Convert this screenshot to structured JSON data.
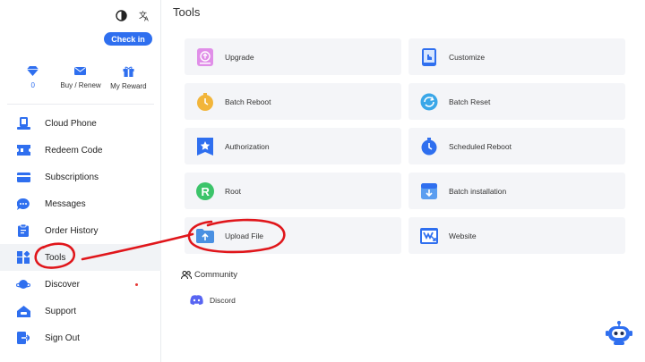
{
  "sidebar": {
    "checkin_label": "Check in",
    "stats": [
      {
        "icon": "diamond-icon",
        "label": "0"
      },
      {
        "icon": "mail-icon",
        "label": "Buy / Renew"
      },
      {
        "icon": "gift-icon",
        "label": "My Reward"
      }
    ],
    "nav": [
      {
        "key": "cloud-phone",
        "label": "Cloud Phone",
        "icon": "phone-icon"
      },
      {
        "key": "redeem-code",
        "label": "Redeem Code",
        "icon": "ticket-icon"
      },
      {
        "key": "subscriptions",
        "label": "Subscriptions",
        "icon": "card-icon"
      },
      {
        "key": "messages",
        "label": "Messages",
        "icon": "chat-icon"
      },
      {
        "key": "order-history",
        "label": "Order History",
        "icon": "clipboard-icon"
      },
      {
        "key": "tools",
        "label": "Tools",
        "icon": "tools-icon",
        "active": true
      },
      {
        "key": "discover",
        "label": "Discover",
        "icon": "planet-icon",
        "badge": "dot"
      },
      {
        "key": "support",
        "label": "Support",
        "icon": "support-icon"
      },
      {
        "key": "sign-out",
        "label": "Sign Out",
        "icon": "sign-out-icon"
      }
    ]
  },
  "main": {
    "title": "Tools",
    "tools": [
      {
        "label": "Upgrade",
        "icon": "upgrade-icon"
      },
      {
        "label": "Customize",
        "icon": "customize-icon"
      },
      {
        "label": "Batch Reboot",
        "icon": "batch-reboot-icon"
      },
      {
        "label": "Batch Reset",
        "icon": "batch-reset-icon"
      },
      {
        "label": "Authorization",
        "icon": "authorization-icon"
      },
      {
        "label": "Scheduled Reboot",
        "icon": "scheduled-reboot-icon"
      },
      {
        "label": "Root",
        "icon": "root-icon"
      },
      {
        "label": "Batch installation",
        "icon": "batch-install-icon"
      },
      {
        "label": "Upload File",
        "icon": "upload-file-icon"
      },
      {
        "label": "Website",
        "icon": "website-icon"
      }
    ],
    "community": {
      "title": "Community",
      "items": [
        {
          "label": "Discord",
          "icon": "discord-icon"
        }
      ]
    }
  },
  "colors": {
    "accent": "#2f6fef",
    "annotation": "#e0161b",
    "card_bg": "#f4f5f8"
  }
}
